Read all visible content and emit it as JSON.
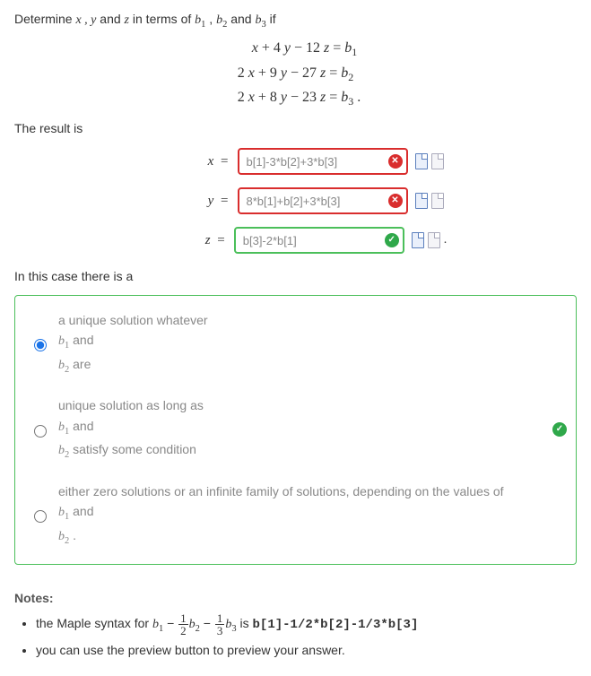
{
  "prompt": {
    "prefix": "Determine ",
    "vars": "x , y",
    "and1": " and ",
    "varz": "z",
    "mid": " in terms of ",
    "b1": "b₁",
    "comma": " , ",
    "b2": "b₂",
    "and2": " and ",
    "b3": "b₃",
    "suffix": " if"
  },
  "equations": {
    "line1": "x + 4 y − 12 z = b₁",
    "line2": "2 x + 9 y − 27 z = b₂",
    "line3": "2 x + 8 y − 23 z = b₃ ."
  },
  "result_label": "The result is",
  "answers": {
    "x": {
      "label": "x =",
      "value": "b[1]-3*b[2]+3*b[3]",
      "status": "incorrect"
    },
    "y": {
      "label": "y =",
      "value": "8*b[1]+b[2]+3*b[3]",
      "status": "incorrect"
    },
    "z": {
      "label": "z =",
      "value": "b[3]-2*b[1]",
      "status": "correct"
    }
  },
  "case_label": "In this case there is a",
  "choices": {
    "opt1": {
      "line1": "a unique solution whatever",
      "b_and": " and",
      "b1": "b₁",
      "b2": "b₂",
      "suffix": " are"
    },
    "opt2": {
      "line1": "unique solution as long as",
      "b_and": " and",
      "b1": "b₁",
      "b2": "b₂",
      "suffix": " satisfy some condition"
    },
    "opt3": {
      "line1": "either zero solutions or an infinite family of solutions, depending on the values of",
      "b_and": " and",
      "b1": "b₁",
      "b2": "b₂",
      "suffix": " ."
    },
    "selected": 0
  },
  "notes": {
    "heading": "Notes:",
    "item1_prefix": "the Maple syntax for ",
    "item1_expr_b1": "b₁",
    "item1_minus": " − ",
    "item1_frac1_num": "1",
    "item1_frac1_den": "2",
    "item1_b2": "b₂",
    "item1_frac2_num": "1",
    "item1_frac2_den": "3",
    "item1_b3": "b₃",
    "item1_is": " is ",
    "item1_code": "b[1]-1/2*b[2]-1/3*b[3]",
    "item2": "you can use the preview button to preview your answer."
  }
}
